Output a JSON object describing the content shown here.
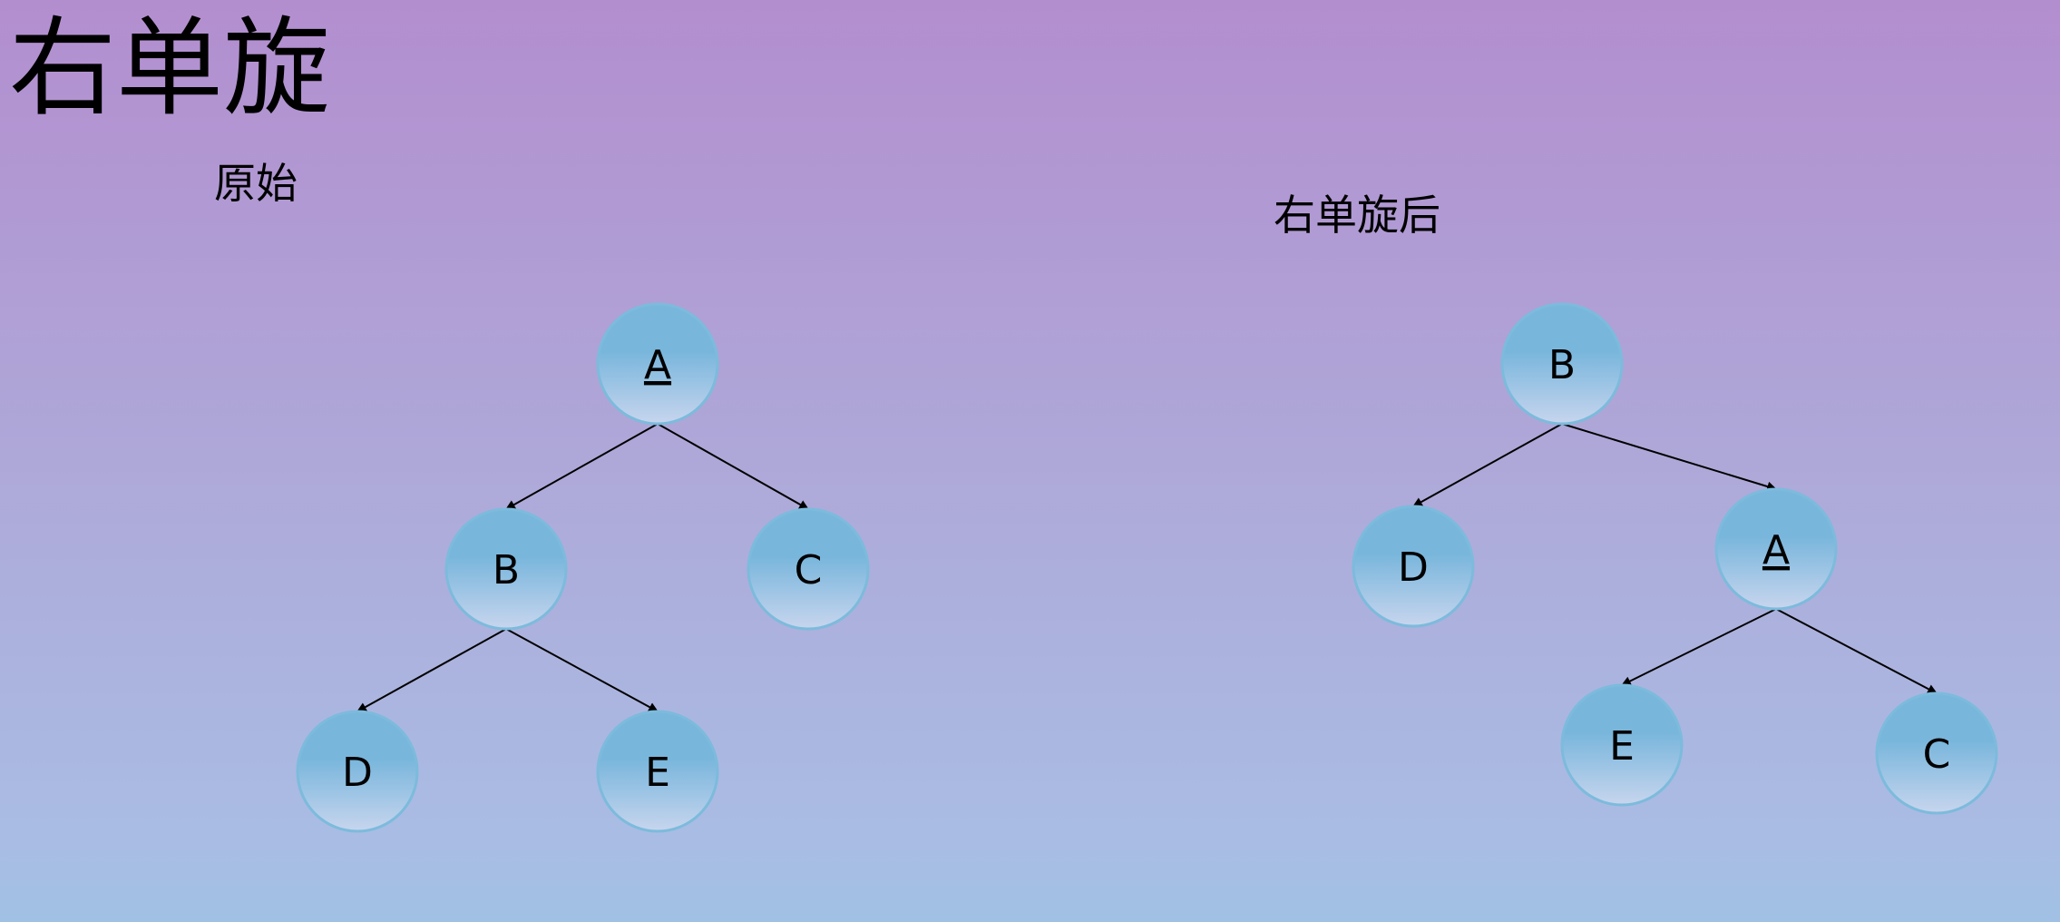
{
  "title": "右单旋",
  "left_tree": {
    "caption": "原始",
    "nodes": [
      {
        "id": "A",
        "label": "A",
        "underline": true
      },
      {
        "id": "B",
        "label": "B",
        "underline": false
      },
      {
        "id": "C",
        "label": "C",
        "underline": false
      },
      {
        "id": "D",
        "label": "D",
        "underline": false
      },
      {
        "id": "E",
        "label": "E",
        "underline": false
      }
    ],
    "edges": [
      [
        "A",
        "B"
      ],
      [
        "A",
        "C"
      ],
      [
        "B",
        "D"
      ],
      [
        "B",
        "E"
      ]
    ]
  },
  "right_tree": {
    "caption": "右单旋后",
    "nodes": [
      {
        "id": "B",
        "label": "B",
        "underline": false
      },
      {
        "id": "D",
        "label": "D",
        "underline": false
      },
      {
        "id": "A",
        "label": "A",
        "underline": true
      },
      {
        "id": "E",
        "label": "E",
        "underline": false
      },
      {
        "id": "C",
        "label": "C",
        "underline": false
      }
    ],
    "edges": [
      [
        "B",
        "D"
      ],
      [
        "B",
        "A"
      ],
      [
        "A",
        "E"
      ],
      [
        "A",
        "C"
      ]
    ]
  },
  "colors": {
    "node_fill_top": "#79b6dc",
    "node_fill_bottom": "#c7d5ee",
    "node_stroke": "#7cbbdc",
    "edge": "#000000"
  }
}
